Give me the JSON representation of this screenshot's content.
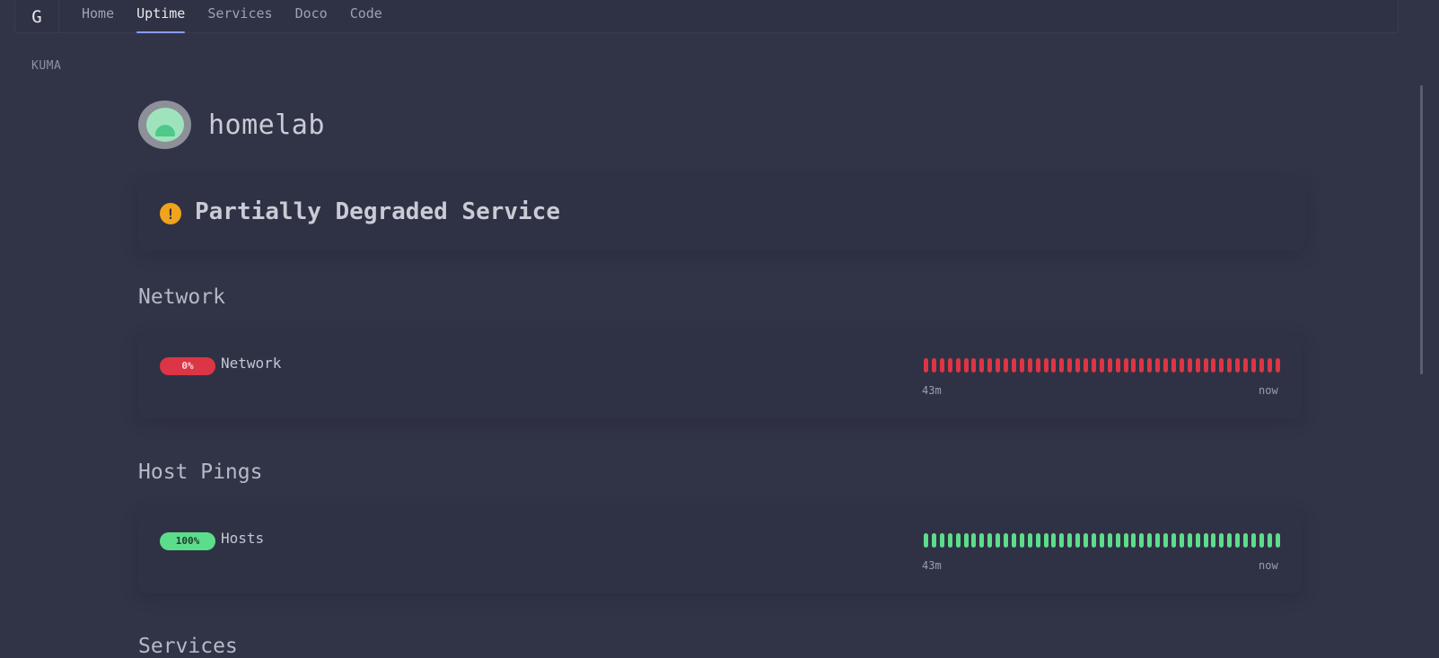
{
  "topbar": {
    "logo": "G",
    "nav": [
      {
        "label": "Home",
        "active": false
      },
      {
        "label": "Uptime",
        "active": true
      },
      {
        "label": "Services",
        "active": false
      },
      {
        "label": "Doco",
        "active": false
      },
      {
        "label": "Code",
        "active": false
      }
    ]
  },
  "section_label": "KUMA",
  "brand": {
    "name": "homelab"
  },
  "overall_status": {
    "text": "Partially Degraded Service",
    "icon": "exclamation-icon",
    "color": "#f0a31b"
  },
  "groups": [
    {
      "title": "Network",
      "monitors": [
        {
          "badge": "0%",
          "name": "Network",
          "status": "down",
          "beat_count": 45,
          "time_start": "43m",
          "time_end": "now"
        }
      ]
    },
    {
      "title": "Host Pings",
      "monitors": [
        {
          "badge": "100%",
          "name": "Hosts",
          "status": "up",
          "beat_count": 45,
          "time_start": "43m",
          "time_end": "now"
        }
      ]
    },
    {
      "title": "Services",
      "monitors": []
    }
  ],
  "colors": {
    "down": "#dc3545",
    "up": "#5cdd8b",
    "accent": "#8c9bf0",
    "background": "#313447"
  }
}
